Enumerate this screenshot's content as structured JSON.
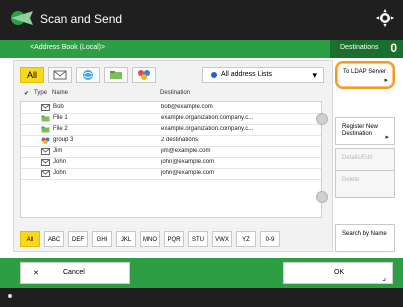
{
  "app": {
    "title": "Scan and Send"
  },
  "subbar": {
    "address_book_label": "<Address Book (Local)>",
    "destinations_label": "Destinations",
    "destinations_count": "0"
  },
  "toolbar": {
    "tabs": [
      {
        "label": "All",
        "selected": true
      },
      {
        "icon": "email-icon"
      },
      {
        "icon": "globe-icon"
      },
      {
        "icon": "folder-icon"
      },
      {
        "icon": "group-icon"
      }
    ],
    "select": {
      "selected": "All address Lists"
    }
  },
  "table": {
    "headers": [
      "Type",
      "Name",
      "Destination"
    ],
    "rows": [
      {
        "icon": "email-icon",
        "name": "Bob",
        "destination": "bob@example.com"
      },
      {
        "icon": "folder-icon",
        "name": "File 1",
        "destination": "example.organization.company.c..."
      },
      {
        "icon": "folder-icon",
        "name": "File 2",
        "destination": "example.organization.company.c..."
      },
      {
        "icon": "group-icon",
        "name": "group 3",
        "destination": "2 destinations"
      },
      {
        "icon": "email-icon",
        "name": "Jim",
        "destination": "jim@example.com"
      },
      {
        "icon": "email-icon",
        "name": "John",
        "destination": "john@example.com"
      },
      {
        "icon": "email-icon",
        "name": "John",
        "destination": "john@example.com"
      }
    ]
  },
  "alphabet": [
    "All",
    "ABC",
    "DEF",
    "GHI",
    "JKL",
    "MNO",
    "PQR",
    "STU",
    "VWX",
    "YZ",
    "0-9"
  ],
  "side_buttons": {
    "to_ldap": "To LDAP Server",
    "register": "Register New Destination",
    "details": "Details/Edit",
    "delete": "Delete",
    "search": "Search by Name"
  },
  "bottom": {
    "cancel": "Cancel",
    "ok": "OK"
  }
}
